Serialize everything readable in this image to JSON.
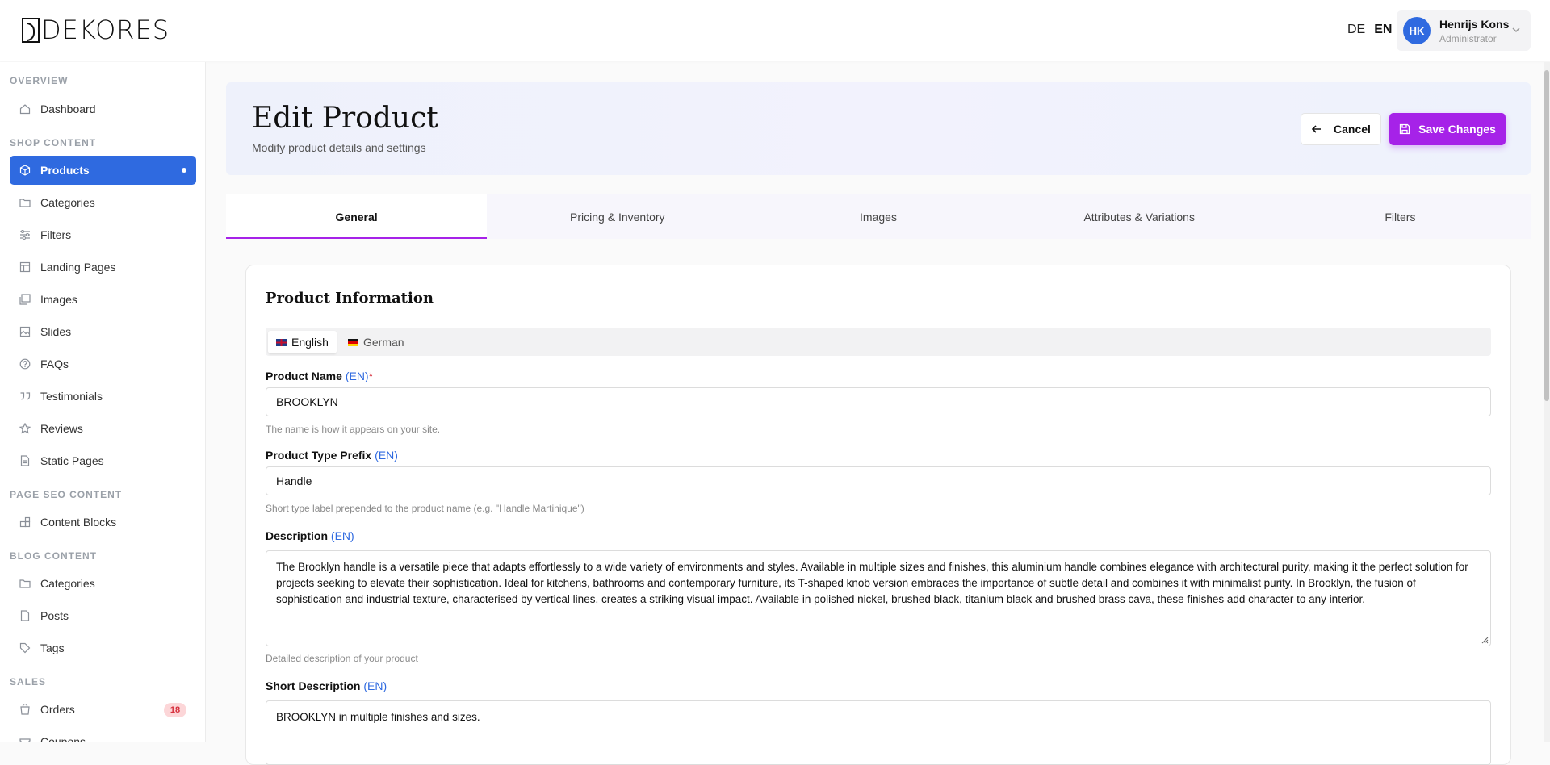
{
  "brand": {
    "logo_text": "DEKORES"
  },
  "topbar": {
    "languages": [
      "DE",
      "EN"
    ],
    "active_language": "EN",
    "user": {
      "initials": "HK",
      "name": "Henrijs Kons",
      "role": "Administrator"
    }
  },
  "sidebar": {
    "sections": [
      {
        "title": "OVERVIEW",
        "items": [
          {
            "label": "Dashboard",
            "icon": "home-icon"
          }
        ]
      },
      {
        "title": "SHOP CONTENT",
        "items": [
          {
            "label": "Products",
            "icon": "box-icon",
            "active": true
          },
          {
            "label": "Categories",
            "icon": "folder-icon"
          },
          {
            "label": "Filters",
            "icon": "sliders-icon"
          },
          {
            "label": "Landing Pages",
            "icon": "layout-icon"
          },
          {
            "label": "Images",
            "icon": "images-icon"
          },
          {
            "label": "Slides",
            "icon": "image-icon"
          },
          {
            "label": "FAQs",
            "icon": "help-circle-icon"
          },
          {
            "label": "Testimonials",
            "icon": "quote-icon"
          },
          {
            "label": "Reviews",
            "icon": "star-icon"
          },
          {
            "label": "Static Pages",
            "icon": "file-icon"
          }
        ]
      },
      {
        "title": "PAGE SEO CONTENT",
        "items": [
          {
            "label": "Content Blocks",
            "icon": "blocks-icon"
          }
        ]
      },
      {
        "title": "BLOG CONTENT",
        "items": [
          {
            "label": "Categories",
            "icon": "folder-icon"
          },
          {
            "label": "Posts",
            "icon": "file-icon"
          },
          {
            "label": "Tags",
            "icon": "tag-icon"
          }
        ]
      },
      {
        "title": "SALES",
        "items": [
          {
            "label": "Orders",
            "icon": "shopping-bag-icon",
            "badge": "18"
          },
          {
            "label": "Coupons",
            "icon": "ticket-icon"
          }
        ]
      }
    ]
  },
  "header": {
    "title": "Edit Product",
    "subtitle": "Modify product details and settings",
    "cancel_label": "Cancel",
    "save_label": "Save Changes"
  },
  "tabs": [
    {
      "label": "General",
      "active": true
    },
    {
      "label": "Pricing & Inventory"
    },
    {
      "label": "Images"
    },
    {
      "label": "Attributes & Variations"
    },
    {
      "label": "Filters"
    }
  ],
  "form": {
    "title": "Product Information",
    "language_tabs": [
      {
        "label": "English",
        "active": true
      },
      {
        "label": "German"
      }
    ],
    "lang_tag": "(EN)",
    "required_mark": "*",
    "product_name": {
      "label": "Product Name",
      "value": "BROOKLYN",
      "hint": "The name is how it appears on your site."
    },
    "type_prefix": {
      "label": "Product Type Prefix",
      "value": "Handle",
      "hint": "Short type label prepended to the product name (e.g. \"Handle Martinique\")"
    },
    "description": {
      "label": "Description",
      "value": "The Brooklyn handle is a versatile piece that adapts effortlessly to a wide variety of environments and styles. Available in multiple sizes and finishes, this aluminium handle combines elegance with architectural purity, making it the perfect solution for projects seeking to elevate their sophistication. Ideal for kitchens, bathrooms and contemporary furniture, its T-shaped knob version embraces the importance of subtle detail and combines it with minimalist purity. In Brooklyn, the fusion of sophistication and industrial texture, characterised by vertical lines, creates a striking visual impact. Available in polished nickel, brushed black, titanium black and brushed brass cava, these finishes add character to any interior.",
      "hint": "Detailed description of your product"
    },
    "short_description": {
      "label": "Short Description",
      "value": "BROOKLYN in multiple finishes and sizes."
    }
  },
  "colors": {
    "primary_blue": "#2f6ae0",
    "accent_purple": "#a622e8",
    "badge_red": "#d6303d"
  }
}
